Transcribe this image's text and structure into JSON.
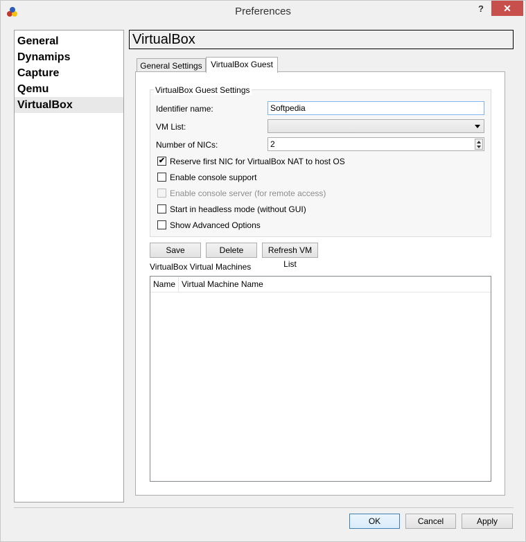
{
  "window": {
    "title": "Preferences",
    "help_label": "?",
    "close_label": "✕"
  },
  "nav": {
    "items": [
      {
        "label": "General"
      },
      {
        "label": "Dynamips"
      },
      {
        "label": "Capture"
      },
      {
        "label": "Qemu"
      },
      {
        "label": "VirtualBox"
      }
    ],
    "selected": "VirtualBox"
  },
  "page": {
    "title": "VirtualBox",
    "tabs": [
      {
        "label": "General Settings"
      },
      {
        "label": "VirtualBox Guest"
      }
    ],
    "active_tab": "VirtualBox Guest"
  },
  "guest_settings": {
    "group_title": "VirtualBox Guest Settings",
    "identifier_label": "Identifier name:",
    "identifier_value": "Softpedia",
    "vm_list_label": "VM List:",
    "vm_list_value": "",
    "nics_label": "Number of NICs:",
    "nics_value": "2",
    "checkboxes": [
      {
        "label": "Reserve first NIC for VirtualBox NAT to host OS",
        "checked": true,
        "enabled": true
      },
      {
        "label": "Enable console support",
        "checked": false,
        "enabled": true
      },
      {
        "label": "Enable console server (for remote access)",
        "checked": false,
        "enabled": false
      },
      {
        "label": "Start in headless mode (without GUI)",
        "checked": false,
        "enabled": true
      },
      {
        "label": "Show Advanced Options",
        "checked": false,
        "enabled": true
      }
    ]
  },
  "actions": {
    "save": "Save",
    "delete": "Delete",
    "refresh": "Refresh VM List"
  },
  "vm_table": {
    "title": "VirtualBox Virtual Machines",
    "columns": [
      "Name",
      "Virtual Machine Name"
    ],
    "rows": []
  },
  "footer": {
    "ok": "OK",
    "cancel": "Cancel",
    "apply": "Apply"
  },
  "colors": {
    "close_button": "#c7504d",
    "input_focus_border": "#7eb4ea",
    "default_button_border": "#3c7fb1"
  }
}
